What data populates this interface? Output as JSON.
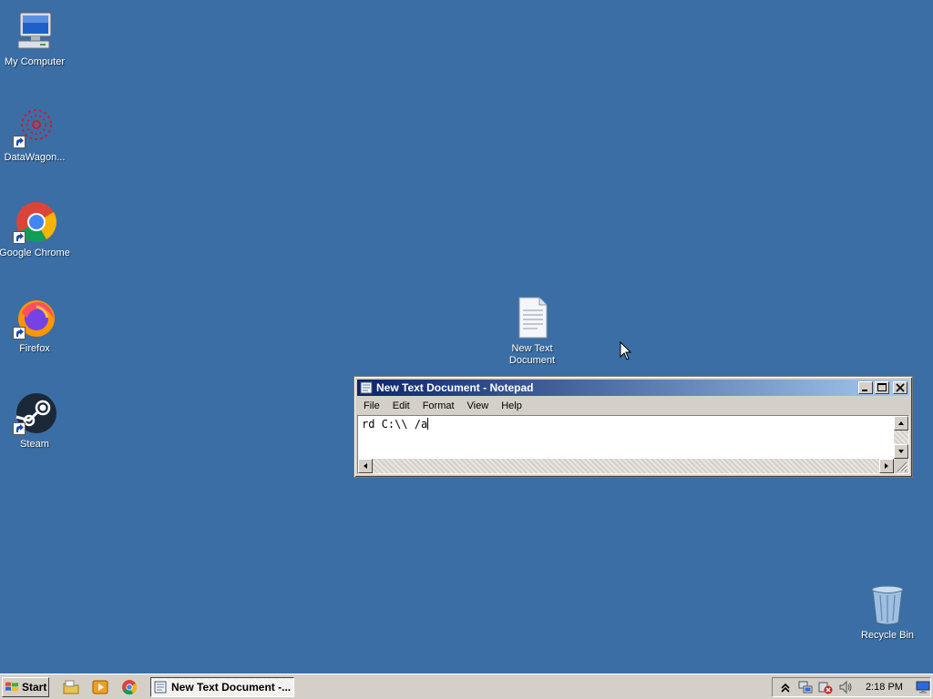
{
  "desktop": {
    "background_color": "#3a6ea5",
    "icons": [
      {
        "label": "My Computer",
        "icon": "computer-icon"
      },
      {
        "label": "DataWagon...",
        "icon": "datawagon-icon"
      },
      {
        "label": "Google Chrome",
        "icon": "chrome-icon"
      },
      {
        "label": "Firefox",
        "icon": "firefox-icon"
      },
      {
        "label": "Steam",
        "icon": "steam-icon"
      },
      {
        "label": "New Text Document",
        "icon": "text-file-icon"
      },
      {
        "label": "Recycle Bin",
        "icon": "recycle-bin-icon"
      }
    ]
  },
  "notepad": {
    "title": "New Text Document - Notepad",
    "menu": [
      "File",
      "Edit",
      "Format",
      "View",
      "Help"
    ],
    "content": "rd C:\\\\ /a",
    "buttons": {
      "minimize": "_",
      "maximize": "□",
      "close": "✕"
    }
  },
  "taskbar": {
    "start_label": "Start",
    "task_label": "New Text Document -...",
    "clock": "2:18 PM",
    "quick_launch": [
      "explorer-icon",
      "media-player-icon",
      "chrome-icon"
    ],
    "tray_icons": [
      "chevron-up-icon",
      "network-icon",
      "security-alert-icon",
      "volume-icon",
      "display-icon"
    ]
  }
}
